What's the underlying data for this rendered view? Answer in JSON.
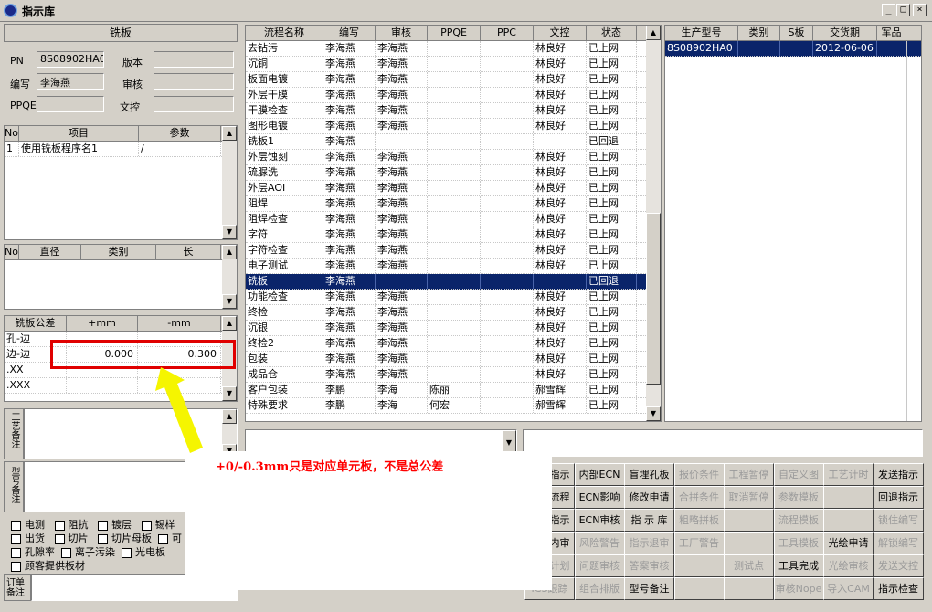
{
  "window": {
    "title": "指示库"
  },
  "board_info": {
    "section_title": "铣板",
    "pn_label": "PN",
    "pn_value": "8S08902HA0",
    "version_label": "版本",
    "version_value": "",
    "writer_label": "编写",
    "writer_value": "李海燕",
    "reviewer_label": "审核",
    "reviewer_value": "",
    "ppqe_label": "PPQE",
    "ppqe_value": "",
    "doc_control_label": "文控",
    "doc_control_value": ""
  },
  "param_table": {
    "headers": [
      "No",
      "项目",
      "参数"
    ],
    "rows": [
      [
        "1",
        "使用铣板程序名1",
        "/"
      ]
    ]
  },
  "dia_table": {
    "headers": [
      "No",
      "直径",
      "类别",
      "长"
    ]
  },
  "tolerance_table": {
    "headers": [
      "铣板公差",
      "+mm",
      "-mm"
    ],
    "rows": [
      [
        "孔-边",
        "",
        ""
      ],
      [
        "边-边",
        "0.000",
        "0.300"
      ],
      [
        ".XX",
        "",
        ""
      ],
      [
        ".XXX",
        "",
        ""
      ]
    ]
  },
  "notes": {
    "process_note_label": "工艺备注",
    "model_note_label": "型号备注",
    "order_note_label": "订单备注"
  },
  "checkboxes": [
    [
      "电测",
      "阻抗",
      "镀层",
      "锡样"
    ],
    [
      "出货",
      "切片",
      "切片母板",
      "可"
    ],
    [
      "孔隙率",
      "离子污染",
      "光电板"
    ],
    [
      "顾客提供板材"
    ]
  ],
  "annotation": {
    "text": "+0/-0.3mm只是对应单元板，不是总公差"
  },
  "process_table": {
    "headers": [
      "流程名称",
      "编写",
      "审核",
      "PPQE",
      "PPC",
      "文控",
      "状态"
    ],
    "rows": [
      [
        "去钻污",
        "李海燕",
        "李海燕",
        "",
        "",
        "林良好",
        "已上网"
      ],
      [
        "沉铜",
        "李海燕",
        "李海燕",
        "",
        "",
        "林良好",
        "已上网"
      ],
      [
        "板面电镀",
        "李海燕",
        "李海燕",
        "",
        "",
        "林良好",
        "已上网"
      ],
      [
        "外层干膜",
        "李海燕",
        "李海燕",
        "",
        "",
        "林良好",
        "已上网"
      ],
      [
        "干膜检查",
        "李海燕",
        "李海燕",
        "",
        "",
        "林良好",
        "已上网"
      ],
      [
        "图形电镀",
        "李海燕",
        "李海燕",
        "",
        "",
        "林良好",
        "已上网"
      ],
      [
        "铣板1",
        "李海燕",
        "",
        "",
        "",
        "",
        "已回退"
      ],
      [
        "外层蚀刻",
        "李海燕",
        "李海燕",
        "",
        "",
        "林良好",
        "已上网"
      ],
      [
        "硫脲洗",
        "李海燕",
        "李海燕",
        "",
        "",
        "林良好",
        "已上网"
      ],
      [
        "外层AOI",
        "李海燕",
        "李海燕",
        "",
        "",
        "林良好",
        "已上网"
      ],
      [
        "阻焊",
        "李海燕",
        "李海燕",
        "",
        "",
        "林良好",
        "已上网"
      ],
      [
        "阻焊检查",
        "李海燕",
        "李海燕",
        "",
        "",
        "林良好",
        "已上网"
      ],
      [
        "字符",
        "李海燕",
        "李海燕",
        "",
        "",
        "林良好",
        "已上网"
      ],
      [
        "字符检查",
        "李海燕",
        "李海燕",
        "",
        "",
        "林良好",
        "已上网"
      ],
      [
        "电子测试",
        "李海燕",
        "李海燕",
        "",
        "",
        "林良好",
        "已上网"
      ],
      [
        "铣板",
        "李海燕",
        "",
        "",
        "",
        "",
        "已回退"
      ],
      [
        "功能检查",
        "李海燕",
        "李海燕",
        "",
        "",
        "林良好",
        "已上网"
      ],
      [
        "终检",
        "李海燕",
        "李海燕",
        "",
        "",
        "林良好",
        "已上网"
      ],
      [
        "沉银",
        "李海燕",
        "李海燕",
        "",
        "",
        "林良好",
        "已上网"
      ],
      [
        "终检2",
        "李海燕",
        "李海燕",
        "",
        "",
        "林良好",
        "已上网"
      ],
      [
        "包装",
        "李海燕",
        "李海燕",
        "",
        "",
        "林良好",
        "已上网"
      ],
      [
        "成品仓",
        "李海燕",
        "李海燕",
        "",
        "",
        "林良好",
        "已上网"
      ],
      [
        "客户包装",
        "李鹏",
        "李海",
        "陈丽",
        "",
        "郝雪辉",
        "已上网"
      ],
      [
        "特殊要求",
        "李鹏",
        "李海",
        "何宏",
        "",
        "郝雪辉",
        "已上网"
      ]
    ],
    "selected_index": 15
  },
  "model_table": {
    "headers": [
      "生产型号",
      "类别",
      "S板",
      "交货期",
      "军品"
    ],
    "rows": [
      [
        "8S08902HA0",
        "",
        "",
        "2012-06-06",
        ""
      ]
    ]
  },
  "buttons": {
    "col1": [
      "复制指示",
      "编写流程",
      "编写指示",
      "指示内审",
      "工具计划",
      "ICS跟踪"
    ],
    "col2": [
      "内部ECN",
      "ECN影响",
      "ECN审核",
      "风险警告",
      "问题审核",
      "组合排版"
    ],
    "col3": [
      "盲埋孔板",
      "修改申请",
      "指 示 库",
      "指示退审",
      "答案审核",
      "型号备注"
    ],
    "col4": [
      "报价条件",
      "合拼条件",
      "粗略拼板",
      "工厂警告",
      "",
      ""
    ],
    "col5": [
      "工程暂停",
      "取消暂停",
      "",
      "",
      "测试点",
      ""
    ],
    "col6": [
      "自定义图",
      "参数模板",
      "流程模板",
      "工具模板",
      "工具完成",
      "审核Nope"
    ],
    "col7": [
      "工艺计时",
      "",
      "",
      "光绘申请",
      "光绘审核",
      "导入CAM"
    ],
    "col8": [
      "发送指示",
      "回退指示",
      "锁住编写",
      "解锁编写",
      "发送文控",
      "指示检查"
    ]
  },
  "disabled_buttons": [
    "工具计划",
    "ICS跟踪",
    "风险警告",
    "问题审核",
    "组合排版",
    "指示退审",
    "答案审核",
    "报价条件",
    "合拼条件",
    "粗略拼板",
    "工厂警告",
    "工程暂停",
    "取消暂停",
    "测试点",
    "自定义图",
    "参数模板",
    "流程模板",
    "工具模板",
    "审核Nope",
    "工艺计时",
    "光绘审核",
    "导入CAM",
    "锁住编写",
    "解锁编写",
    "发送文控"
  ],
  "colors": {
    "selection": "#0a246a",
    "highlight_box": "#e00000",
    "arrow": "#f5f500",
    "annotation_text": "#ff0000"
  }
}
